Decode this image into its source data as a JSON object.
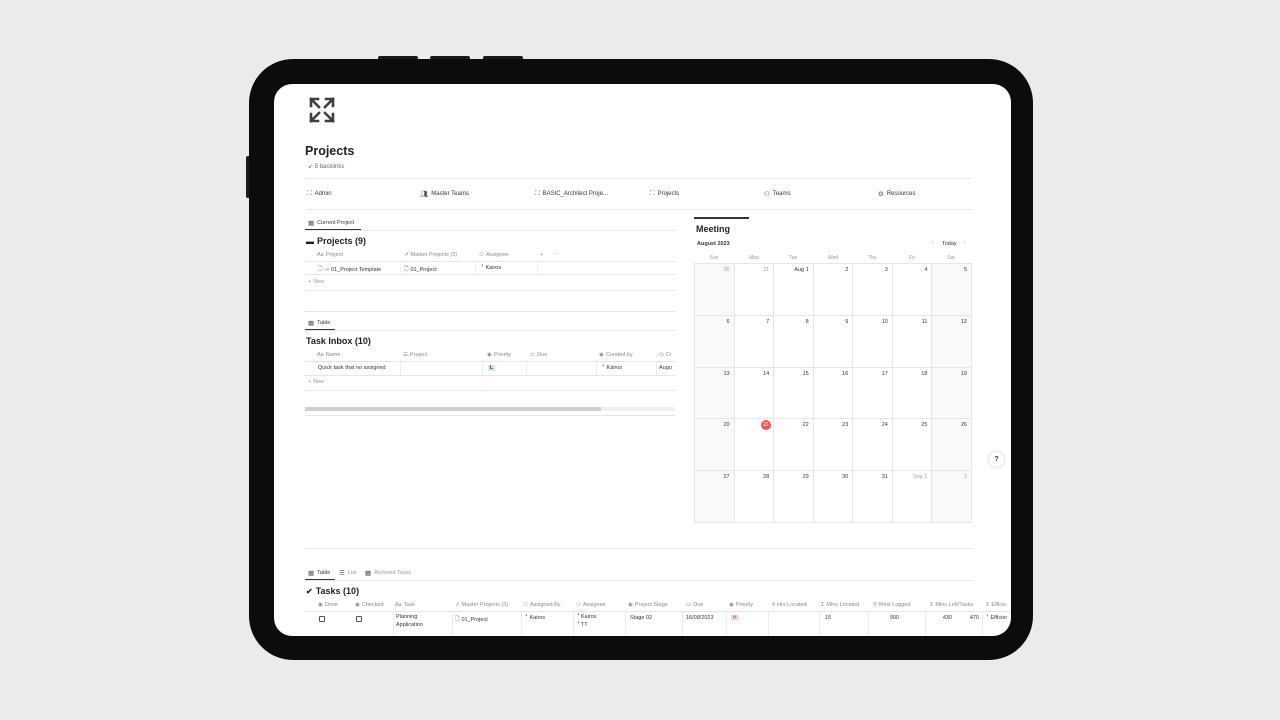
{
  "page": {
    "title": "Projects",
    "backlinks": "5 backlinks"
  },
  "nav": [
    {
      "label": "Admin",
      "icon": "admin-icon"
    },
    {
      "label": "Master Teams",
      "icon": "people-icon"
    },
    {
      "label": "BASIC_Architect Proje...",
      "icon": "project-icon"
    },
    {
      "label": "Projects",
      "icon": "projects-icon"
    },
    {
      "label": "Teams",
      "icon": "teams-icon"
    },
    {
      "label": "Resources",
      "icon": "resources-icon"
    }
  ],
  "projects_view": {
    "tab": "Current Project",
    "heading": "Projects (9)",
    "columns": [
      "Project",
      "Master Projects (3)",
      "Assignee"
    ],
    "rows": [
      {
        "project": "01_Project Template",
        "master": "01_Project",
        "assignee": "Kairos"
      }
    ],
    "new_label": "New"
  },
  "inbox_view": {
    "tab": "Table",
    "heading": "Task Inbox (10)",
    "columns": [
      "Name",
      "Project",
      "Priority",
      "Due",
      "Created by",
      "Cr"
    ],
    "rows": [
      {
        "name": "Quick task that no assigned",
        "project": "",
        "priority": "L",
        "due": "",
        "created_by": "Kairos",
        "created": "Augu"
      }
    ],
    "new_label": "New"
  },
  "calendar": {
    "title": "Meeting",
    "month": "August 2023",
    "today_label": "Today",
    "days_of_week": [
      "Sun",
      "Mon",
      "Tue",
      "Wed",
      "Thu",
      "Fri",
      "Sat"
    ],
    "dates": [
      "30",
      "31",
      "Aug 1",
      "2",
      "3",
      "4",
      "5",
      "6",
      "7",
      "8",
      "9",
      "10",
      "11",
      "12",
      "13",
      "14",
      "15",
      "16",
      "17",
      "18",
      "19",
      "20",
      "21",
      "22",
      "23",
      "24",
      "25",
      "26",
      "27",
      "28",
      "29",
      "30",
      "31",
      "Sep 1",
      "2"
    ],
    "today": "21",
    "today_color": "#eb5757"
  },
  "tasks_view": {
    "tabs": [
      "Table",
      "List",
      "Archived Tasks"
    ],
    "heading": "Tasks (10)",
    "columns": [
      "Done",
      "Checked",
      "Task",
      "Master Projects (3)",
      "Assigned By",
      "Assignee",
      "Project Stage",
      "Due",
      "Priority",
      "Hrs Located",
      "Mins Located",
      "Mins Logged",
      "Mins Left/Tasks",
      "Efficie"
    ],
    "rows": [
      {
        "task_line1": "Planning",
        "task_line2": "Application",
        "master": "01_Project",
        "assigned_by": "Kairos",
        "assignee1": "Kairos",
        "assignee2": "TT",
        "stage": "Stage 02",
        "due": "16/08/2023",
        "priority": "H",
        "hrs_located": "15",
        "mins_located": "900",
        "mins_logged": "430",
        "mins_left": "470",
        "efficiency": "Efficier"
      }
    ]
  },
  "help": "?"
}
